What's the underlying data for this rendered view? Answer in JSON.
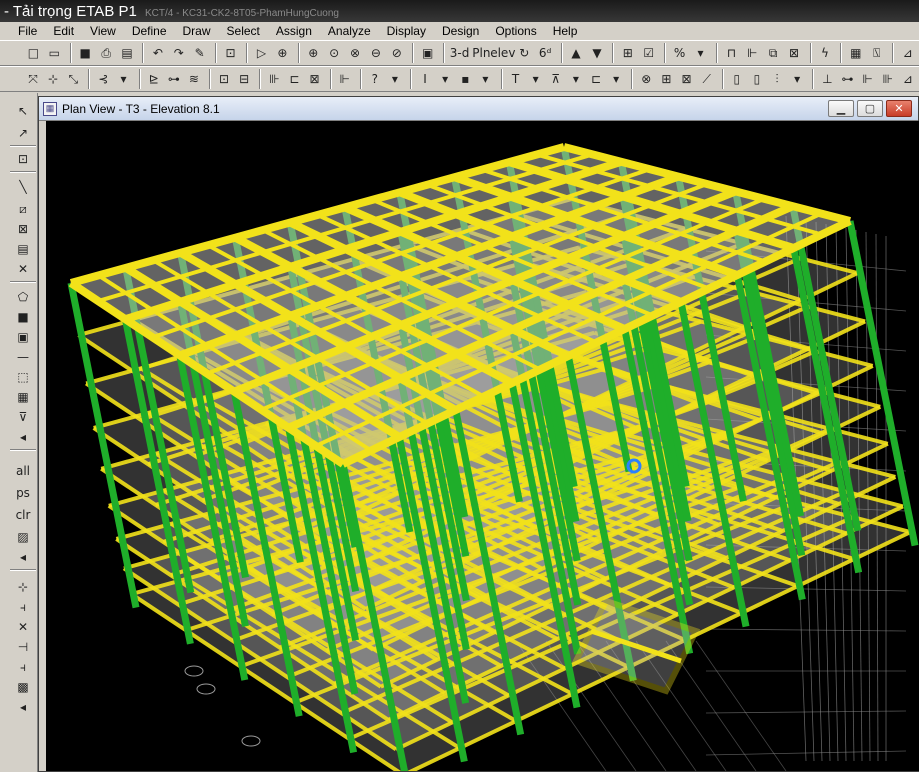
{
  "app": {
    "video_title": "- Tải trọng ETAB P1",
    "faded_caption": "KCT/4 - KC31-CK2-8T05-PhamHungCuong"
  },
  "menu": [
    "File",
    "Edit",
    "View",
    "Define",
    "Draw",
    "Select",
    "Assign",
    "Analyze",
    "Display",
    "Design",
    "Options",
    "Help"
  ],
  "toolbar": {
    "view_3d": "3-d",
    "plan": "Pln",
    "elev": "elev"
  },
  "left_toolbar": {
    "all": "all",
    "ps": "ps",
    "clr": "clr"
  },
  "window": {
    "title": "Plan View - T3 - Elevation 8.1"
  },
  "colors": {
    "beam": "#f2e21a",
    "column": "#1fae2a",
    "slab": "#b4b4b4",
    "grid": "#8a8a8a",
    "background": "#000000"
  },
  "icons": [
    "new-icon",
    "open-icon",
    "save-icon",
    "print-icon",
    "undo-icon",
    "redo-icon",
    "pencil-icon",
    "lock-icon",
    "zoom-icon",
    "pointer-icon",
    "line-icon",
    "area-icon"
  ]
}
